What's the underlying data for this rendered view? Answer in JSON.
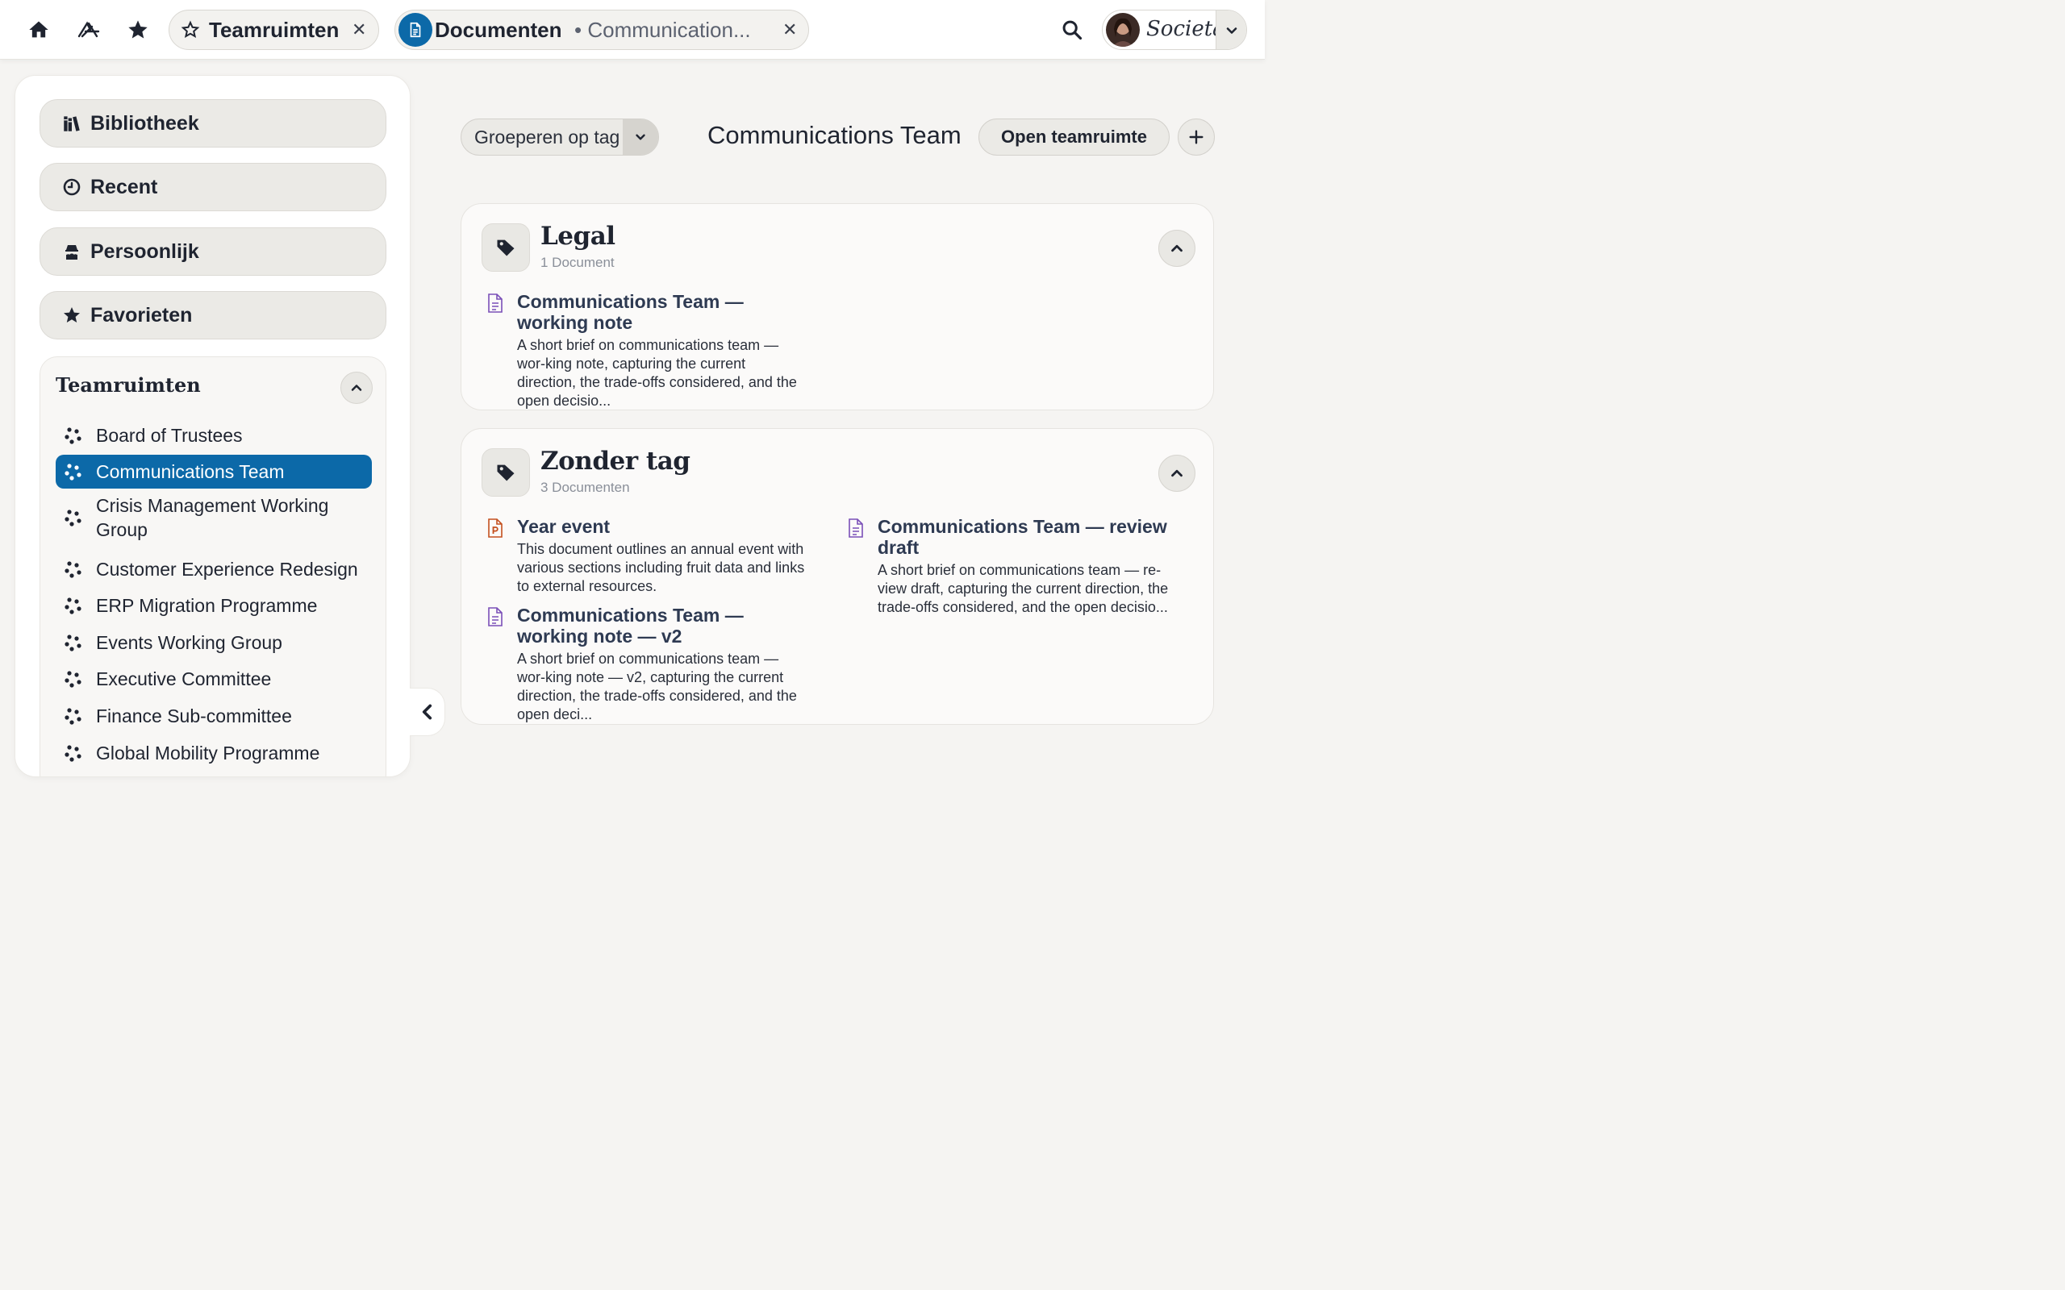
{
  "topbar": {
    "tabs": [
      {
        "title": "Teamruimten",
        "subtitle": ""
      },
      {
        "title": "Documenten",
        "subtitle": "• Communication..."
      }
    ],
    "user": {
      "brand": "Societas"
    }
  },
  "sidebar": {
    "nav": [
      {
        "label": "Bibliotheek",
        "icon": "books-icon"
      },
      {
        "label": "Recent",
        "icon": "clock-icon"
      },
      {
        "label": "Persoonlijk",
        "icon": "incognito-icon"
      },
      {
        "label": "Favorieten",
        "icon": "star-icon"
      }
    ],
    "teams_title": "Teamruimten",
    "teams": [
      "Board of Trustees",
      "Communications Team",
      "Crisis Management Working Group",
      "Customer Experience Redesign",
      "ERP Migration Programme",
      "Events Working Group",
      "Executive Committee",
      "Finance Sub-committee",
      "Global Mobility Programme"
    ],
    "active_team": "Communications Team"
  },
  "main": {
    "group_by_label": "Groeperen op tag",
    "team_title": "Communications Team",
    "open_button": "Open teamruimte",
    "groups": [
      {
        "title": "Legal",
        "count": "1 Document",
        "docs": [
          {
            "type": "text-document",
            "title": "Communications Team — working note",
            "desc": "A short brief on communications team — wor-king note, capturing the current direction, the trade-offs considered, and the open decisio..."
          }
        ]
      },
      {
        "title": "Zonder tag",
        "count": "3 Documenten",
        "docs": [
          {
            "type": "presentation",
            "title": "Year event",
            "desc": "This document outlines an annual event with various sections including fruit data and links to external resources."
          },
          {
            "type": "text-document",
            "title": "Communications Team — working note — v2",
            "desc": "A short brief on communications team — wor-king note — v2, capturing the current direction, the trade-offs considered, and the open deci..."
          },
          {
            "type": "text-document",
            "title": "Communications Team — review draft",
            "desc": "A short brief on communications team — re-view draft, capturing the current direction, the trade-offs considered, and the open decisio..."
          }
        ]
      }
    ]
  },
  "colors": {
    "accent": "#0c69a8",
    "doc_icon": "#7a4fb8",
    "presentation_icon": "#c4501f"
  }
}
